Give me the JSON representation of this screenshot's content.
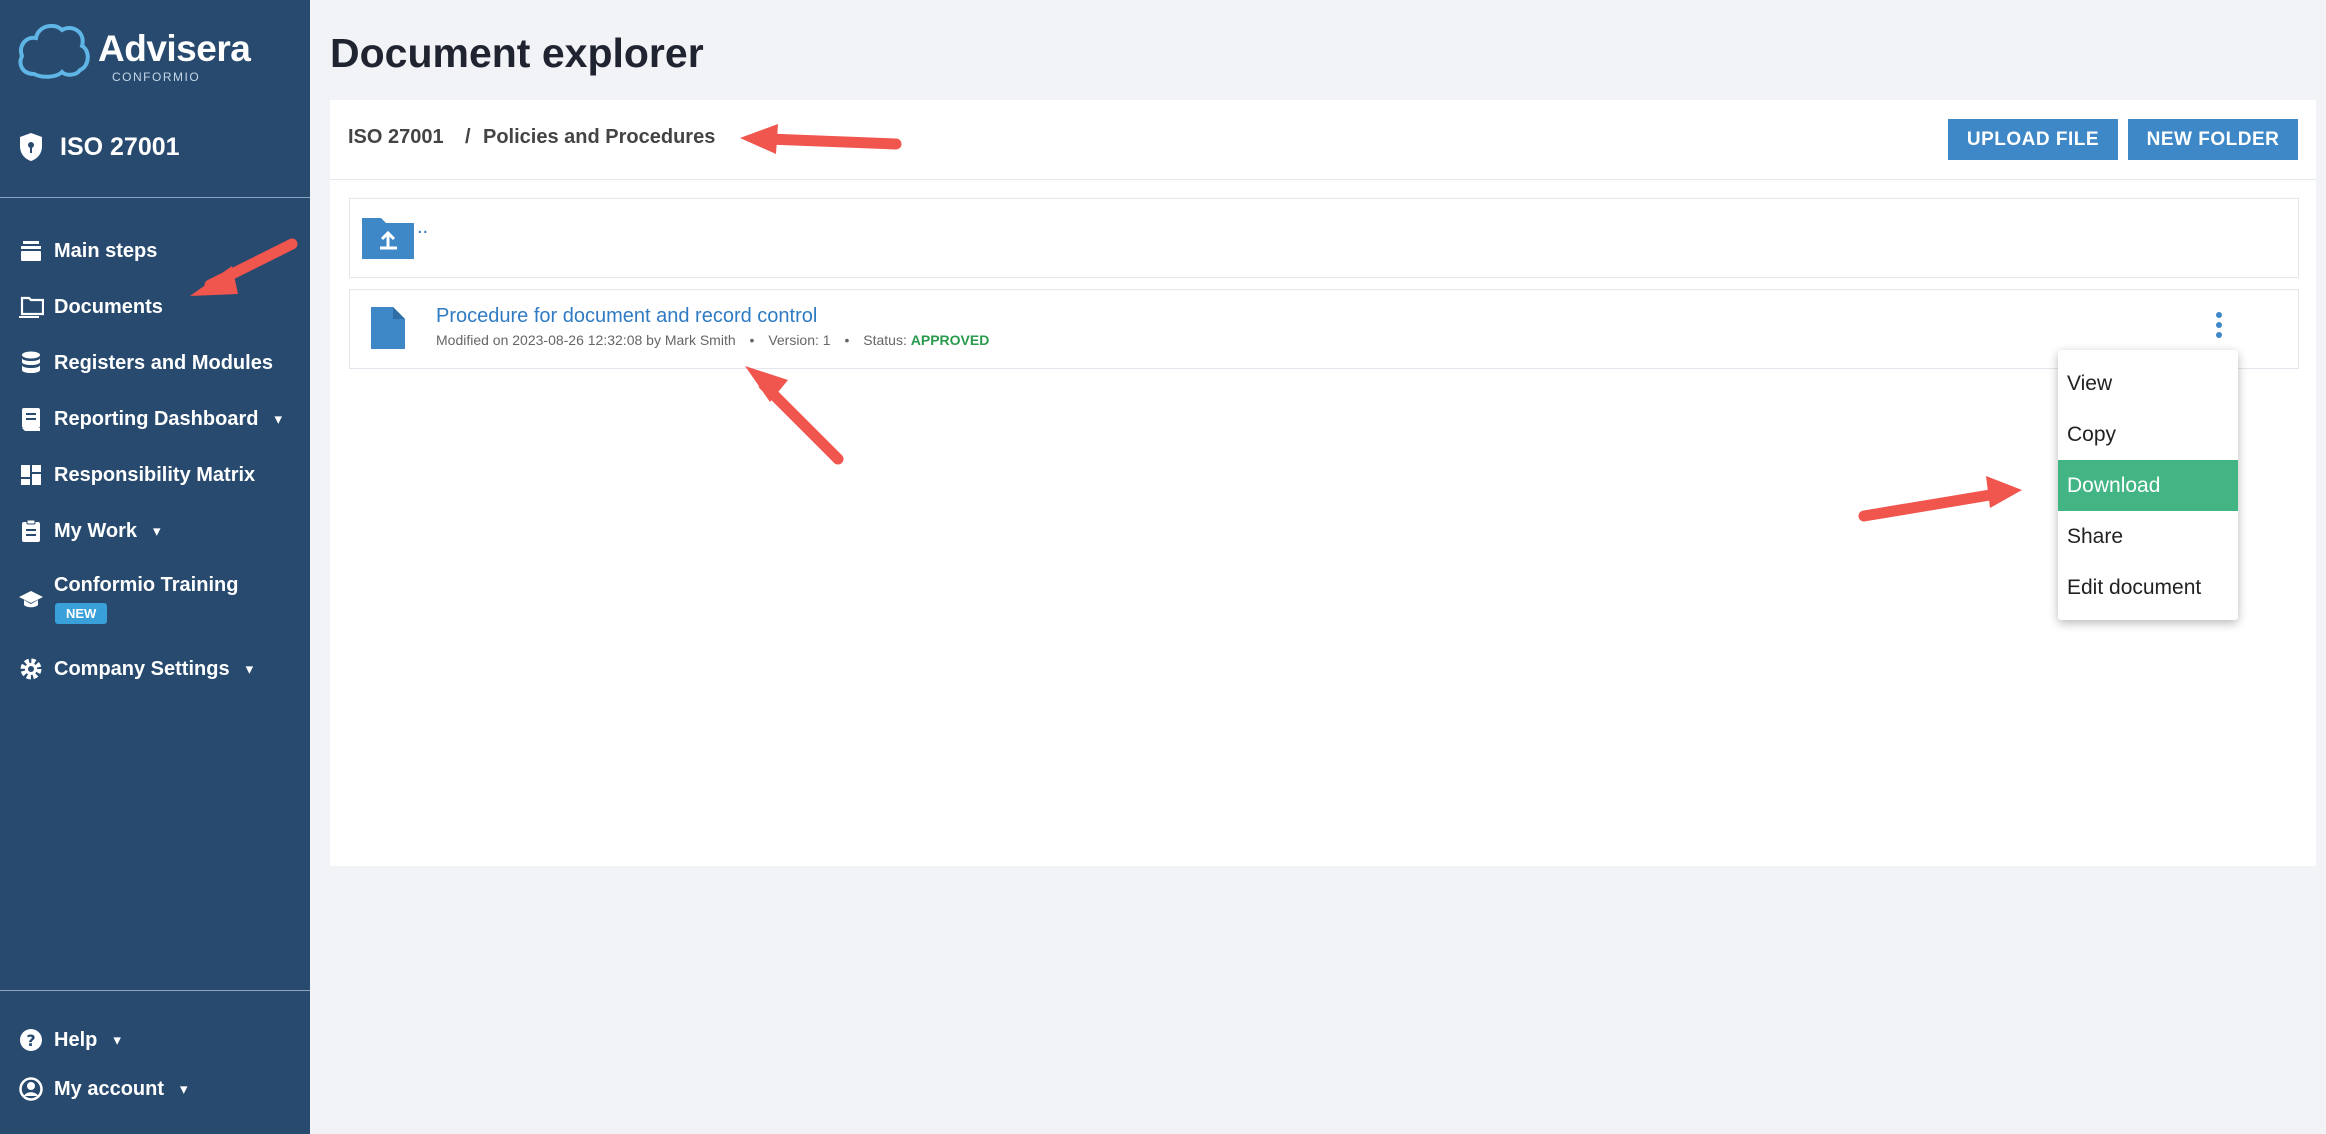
{
  "sidebar": {
    "brand": "Advisera",
    "brand_sub": "CONFORMIO",
    "product": "ISO 27001",
    "items": [
      {
        "label": "Main steps",
        "icon": "stack-icon"
      },
      {
        "label": "Documents",
        "icon": "folder-icon"
      },
      {
        "label": "Registers and Modules",
        "icon": "database-icon"
      },
      {
        "label": "Reporting Dashboard",
        "icon": "report-icon"
      },
      {
        "label": "Responsibility Matrix",
        "icon": "dashboard-icon"
      },
      {
        "label": "My Work",
        "icon": "clipboard-icon"
      },
      {
        "label": "Conformio Training",
        "icon": "graduation-cap-icon"
      },
      {
        "label": "Company Settings",
        "icon": "gear-icon"
      }
    ],
    "training_badge": "NEW",
    "footer": [
      {
        "label": "Help",
        "icon": "help-icon"
      },
      {
        "label": "My account",
        "icon": "account-icon"
      }
    ]
  },
  "main": {
    "title": "Document explorer",
    "breadcrumb": {
      "root": "ISO 27001",
      "separator": "/",
      "current": "Policies and Procedures"
    },
    "buttons": {
      "upload": "Upload file",
      "new_folder": "New folder"
    },
    "parent_link": "..",
    "document": {
      "title": "Procedure for document and record control",
      "modified": "Modified on 2023-08-26 12:32:08 by Mark Smith",
      "version": "Version: 1",
      "status_label": "Status:",
      "status_value": "APPROVED"
    },
    "context_menu": [
      "View",
      "Copy",
      "Download",
      "Share",
      "Edit document"
    ],
    "context_menu_active": "Download"
  },
  "colors": {
    "sidebar": "#274a6e",
    "accent": "#3f88c7",
    "highlight": "#43b584",
    "annotation": "#f0554e"
  }
}
